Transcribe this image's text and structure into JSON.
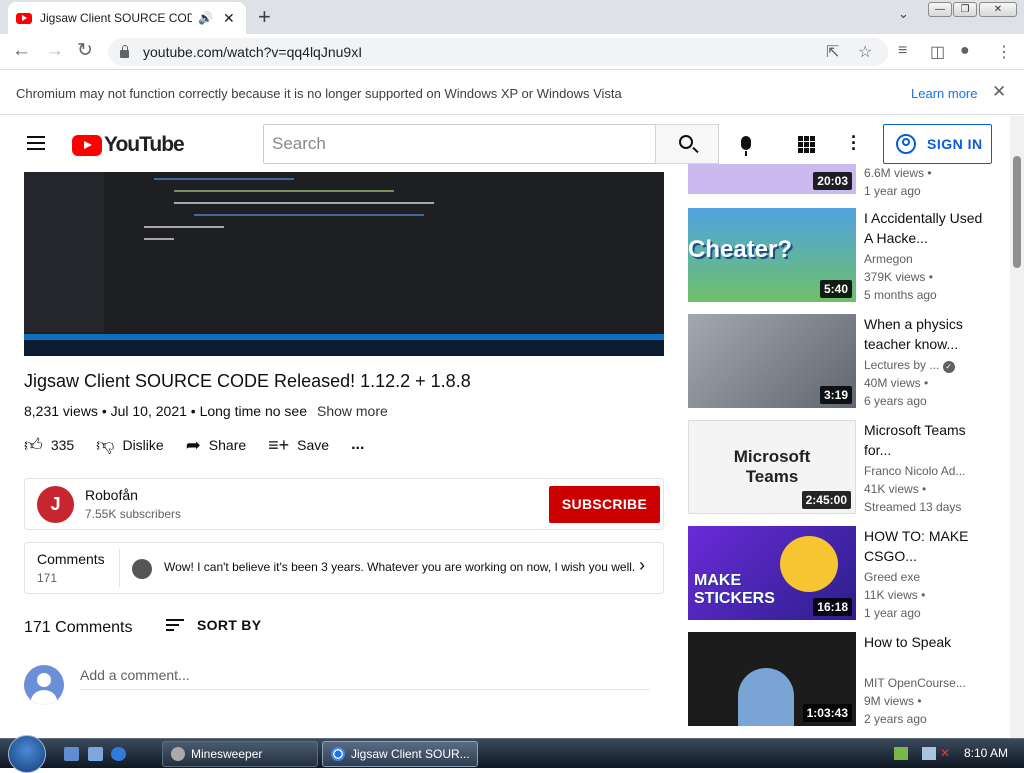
{
  "browser": {
    "tab_title": "Jigsaw Client SOURCE CODE",
    "tab_audio_icon": "speaker-icon",
    "url": "youtube.com/watch?v=qq4lqJnu9xI",
    "infobar_message": "Chromium may not function correctly because it is no longer supported on Windows XP or Windows Vista",
    "infobar_link": "Learn more"
  },
  "yt_header": {
    "logo_text": "YouTube",
    "search_placeholder": "Search",
    "sign_in_label": "SIGN IN"
  },
  "video": {
    "title": "Jigsaw Client SOURCE CODE Released! 1.12.2 + 1.8.8",
    "meta": "8,231 views • Jul 10, 2021 • Long time no see",
    "show_more": "Show more",
    "likes": "335",
    "dislike_label": "Dislike",
    "share_label": "Share",
    "save_label": "Save",
    "more_actions": "..."
  },
  "channel": {
    "name": "Robofån",
    "subscribers": "7.55K subscribers",
    "avatar_text": "J",
    "subscribe_label": "SUBSCRIBE"
  },
  "comments_teaser": {
    "label": "Comments",
    "count": "171",
    "top_comment": "Wow! I can't believe it's been 3 years. Whatever you are working on now, I wish you well."
  },
  "comments": {
    "count_label": "171 Comments",
    "sort_label": "SORT BY",
    "add_placeholder": "Add a comment..."
  },
  "sidebar": [
    {
      "title": "",
      "channel": "",
      "views": "6.6M views •",
      "age": "1 year ago",
      "duration": "20:03",
      "thumb_color": "#cbb9f0"
    },
    {
      "title": "I Accidentally Used A Hacke...",
      "channel": "Armegon",
      "views": "379K views •",
      "age": "5 months ago",
      "duration": "5:40",
      "thumb_text": "Cheater?",
      "thumb_color": "#4fa3e0"
    },
    {
      "title": "When a physics teacher know...",
      "channel": "Lectures by ...",
      "verified": true,
      "views": "40M views •",
      "age": "6 years ago",
      "duration": "3:19",
      "thumb_color": "#8a8f96"
    },
    {
      "title": "Microsoft Teams for...",
      "channel": "Franco Nicolo Ad...",
      "views": "41K views •",
      "age": "Streamed 13 days",
      "duration": "2:45:00",
      "thumb_text": "Microsoft Teams",
      "thumb_color": "#f4f4f4"
    },
    {
      "title": "HOW TO: MAKE CSGO...",
      "channel": "Greed exe",
      "views": "11K views •",
      "age": "1 year ago",
      "duration": "16:18",
      "thumb_text": "MAKE STICKERS",
      "thumb_color": "#5b2bd6"
    },
    {
      "title": "How to Speak",
      "channel": "MIT OpenCourse...",
      "views": "9M views •",
      "age": "2 years ago",
      "duration": "1:03:43",
      "thumb_color": "#222"
    }
  ],
  "taskbar": {
    "items": [
      {
        "label": "Minesweeper",
        "active": false
      },
      {
        "label": "Jigsaw Client SOUR...",
        "active": true
      }
    ],
    "clock": "8:10 AM"
  }
}
